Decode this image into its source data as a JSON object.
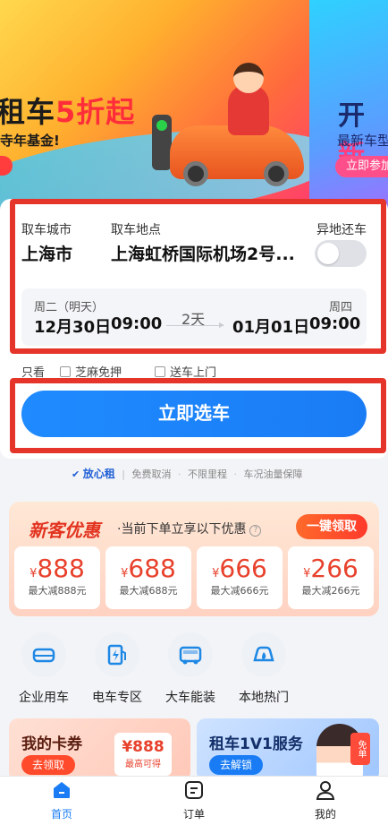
{
  "banner": {
    "slide1": {
      "title_left": "租车",
      "title_hl": "5折起",
      "subtitle": "寺年基金!"
    },
    "slide2": {
      "title_left": "开",
      "title_hl": "新",
      "subtitle": "最新车型",
      "button": "立即参加"
    }
  },
  "booking": {
    "city_label": "取车城市",
    "city_value": "上海市",
    "location_label": "取车地点",
    "location_value": "上海虹桥国际机场2号...",
    "return_label": "异地还车",
    "return_toggle_on": false,
    "pickup_day": "周二（明天）",
    "pickup_date": "12月30日",
    "pickup_time": "09:00",
    "duration": "2天",
    "return_day": "周四",
    "return_date": "01月01日",
    "return_time": "09:00",
    "options": {
      "only_label": "只看",
      "opt1": "芝麻免押",
      "opt2": "送车上门"
    },
    "submit": "立即选车"
  },
  "assurance": {
    "brand": "放心租",
    "items": [
      "免费取消",
      "不限里程",
      "车况油量保障"
    ]
  },
  "coupon": {
    "title": "新客优惠",
    "desc": "·当前下单立享以下优惠",
    "help_icon": "?",
    "button": "一键领取",
    "items": [
      {
        "currency": "¥",
        "amount": "888",
        "note": "最大减888元"
      },
      {
        "currency": "¥",
        "amount": "688",
        "note": "最大减688元"
      },
      {
        "currency": "¥",
        "amount": "666",
        "note": "最大减666元"
      },
      {
        "currency": "¥",
        "amount": "266",
        "note": "最大减266元"
      }
    ]
  },
  "services": [
    {
      "label": "企业用车",
      "icon": "business-car-icon"
    },
    {
      "label": "电车专区",
      "icon": "ev-charging-icon"
    },
    {
      "label": "大车能装",
      "icon": "van-icon"
    },
    {
      "label": "本地热门",
      "icon": "local-hot-icon"
    }
  ],
  "promos": {
    "cards": {
      "title": "我的卡券",
      "button": "去领取",
      "value": "¥888",
      "note": "最高可得"
    },
    "vip": {
      "title": "租车1V1服务",
      "button": "去解锁",
      "tag": "免单"
    }
  },
  "tabbar": {
    "items": [
      {
        "label": "首页",
        "icon": "home-icon",
        "active": true
      },
      {
        "label": "订单",
        "icon": "order-icon",
        "active": false
      },
      {
        "label": "我的",
        "icon": "profile-icon",
        "active": false
      }
    ]
  },
  "colors": {
    "primary": "#1a7cf5",
    "highlight_frame": "#e5352a",
    "coupon_red": "#e8412c"
  }
}
